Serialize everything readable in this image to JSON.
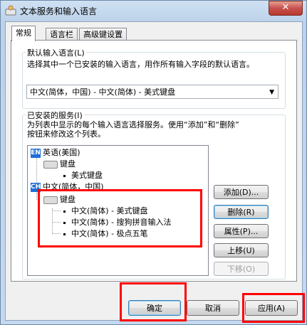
{
  "window": {
    "title": "文本服务和输入语言",
    "close_label": "✕"
  },
  "tabs": [
    {
      "label": "常规",
      "active": true
    },
    {
      "label": "语言栏",
      "active": false
    },
    {
      "label": "高级键设置",
      "active": false
    }
  ],
  "default_group": {
    "label": "默认输入语言(L)",
    "description": "选择其中一个已安装的输入语言，用作所有输入字段的默认语言。",
    "selected": "中文(简体，中国) - 中文(简体) - 美式键盘"
  },
  "services_group": {
    "label": "已安装的服务(I)",
    "description_line1": "为列表中显示的每个输入语言选择服务。使用“添加”和“删除”",
    "description_line2": "按钮来修改这个列表。",
    "tree": {
      "lang1_badge": "EN",
      "lang1": "英语(美国)",
      "lang1_kb": "键盘",
      "lang1_item": "美式键盘",
      "lang2_badge": "CH",
      "lang2": "中文(简体，中国)",
      "lang2_kb": "键盘",
      "lang2_items": [
        "中文(简体) - 美式键盘",
        "中文(简体) - 搜狗拼音输入法",
        "中文(简体) - 极点五笔"
      ]
    },
    "buttons": {
      "add": "添加(D)...",
      "remove": "删除(R)",
      "properties": "属性(P)...",
      "move_up": "上移(U)",
      "move_down": "下移(O)"
    }
  },
  "footer": {
    "ok": "确定",
    "cancel": "取消",
    "apply": "应用(A)"
  },
  "colors": {
    "highlight": "#ff0000",
    "badge": "#1f6fd6"
  }
}
